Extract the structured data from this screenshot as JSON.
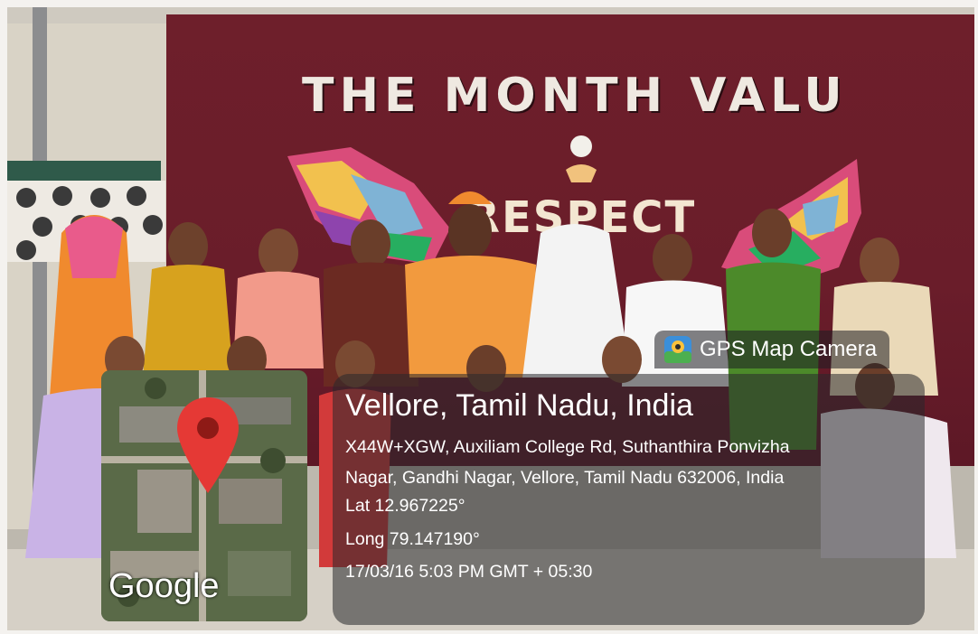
{
  "banner": {
    "title": "THE MONTH VALU",
    "theme_word": "RESPECT"
  },
  "overlay": {
    "app_name": "GPS Map Camera",
    "app_icon": "gps-map-camera-icon",
    "location_title": "Vellore, Tamil Nadu, India",
    "address_line_1": "X44W+XGW, Auxiliam College Rd, Suthanthira Ponvizha",
    "address_line_2": "Nagar, Gandhi Nagar, Vellore, Tamil Nadu 632006, India",
    "latitude": "Lat 12.967225°",
    "longitude": "Long 79.147190°",
    "timestamp": "17/03/16 5:03 PM GMT + 05:30",
    "map_attribution": "Google",
    "map_pin_icon": "map-pin-icon"
  },
  "colors": {
    "backdrop": "#6e1f2b",
    "pin": "#e53935",
    "overlay": "#28282c"
  }
}
